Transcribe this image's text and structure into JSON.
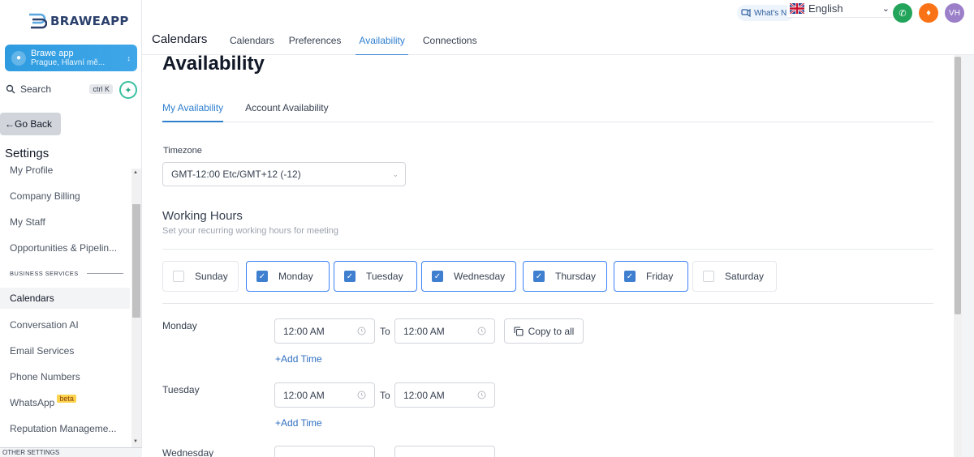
{
  "brand": {
    "logo_text": "BRAWEAPP"
  },
  "account": {
    "name": "Brawe app",
    "location": "Prague, Hlavní mě..."
  },
  "search": {
    "label": "Search",
    "shortcut": "ctrl K"
  },
  "go_back": "Go Back",
  "settings_title": "Settings",
  "sidebar": {
    "items": [
      {
        "label": "My Profile"
      },
      {
        "label": "Company Billing"
      },
      {
        "label": "My Staff"
      },
      {
        "label": "Opportunities & Pipelin..."
      },
      {
        "label": "Calendars"
      },
      {
        "label": "Conversation AI"
      },
      {
        "label": "Email Services"
      },
      {
        "label": "Phone Numbers"
      },
      {
        "label": "WhatsApp"
      },
      {
        "label": "Reputation Manageme..."
      }
    ],
    "section_business": "BUSINESS SERVICES",
    "section_other": "OTHER SETTINGS",
    "beta_badge": "beta",
    "active": "Calendars"
  },
  "topbar": {
    "heading": "Calendars",
    "tabs": [
      "Calendars",
      "Preferences",
      "Availability",
      "Connections"
    ],
    "active_tab": "Availability",
    "whats_new": "What's N",
    "language": "English",
    "avatar_initials": "VH"
  },
  "availability": {
    "title": "Availability",
    "subtabs": [
      "My Availability",
      "Account Availability"
    ],
    "active_subtab": "My Availability",
    "timezone_label": "Timezone",
    "timezone_value": "GMT-12:00 Etc/GMT+12 (-12)",
    "working_hours_title": "Working Hours",
    "working_hours_subtitle": "Set your recurring working hours for meeting",
    "days": [
      {
        "label": "Sunday",
        "checked": false
      },
      {
        "label": "Monday",
        "checked": true
      },
      {
        "label": "Tuesday",
        "checked": true
      },
      {
        "label": "Wednesday",
        "checked": true
      },
      {
        "label": "Thursday",
        "checked": true
      },
      {
        "label": "Friday",
        "checked": true
      },
      {
        "label": "Saturday",
        "checked": false
      }
    ],
    "schedule": [
      {
        "day": "Monday",
        "from": "12:00 AM",
        "to": "12:00 AM"
      },
      {
        "day": "Tuesday",
        "from": "12:00 AM",
        "to": "12:00 AM"
      },
      {
        "day": "Wednesday"
      }
    ],
    "to_label": "To",
    "copy_to_all": "Copy to all",
    "add_time": "Add Time"
  },
  "colors": {
    "accent": "#2f7fcf",
    "account_gradient": "#2e9be0",
    "check": "#3f7fd0"
  }
}
